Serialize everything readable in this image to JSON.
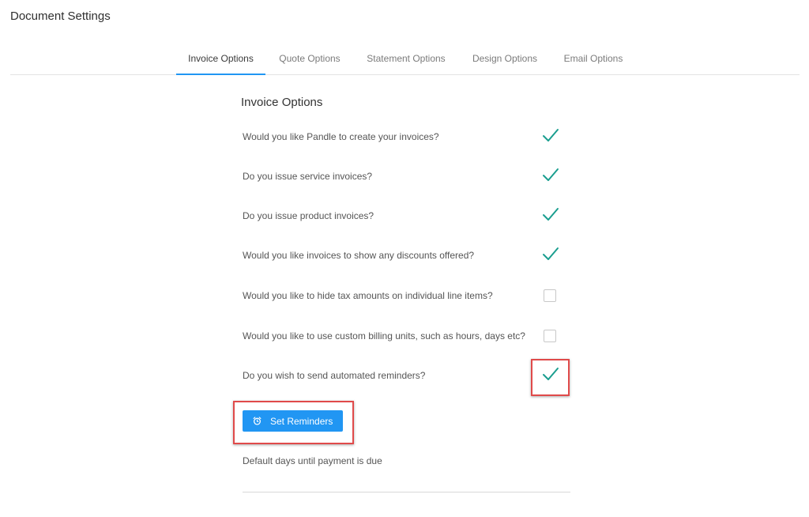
{
  "page": {
    "title": "Document Settings"
  },
  "tabs": [
    {
      "label": "Invoice Options",
      "active": true
    },
    {
      "label": "Quote Options",
      "active": false
    },
    {
      "label": "Statement Options",
      "active": false
    },
    {
      "label": "Design Options",
      "active": false
    },
    {
      "label": "Email Options",
      "active": false
    }
  ],
  "section": {
    "title": "Invoice Options"
  },
  "options": [
    {
      "label": "Would you like Pandle to create your invoices?",
      "checked": true
    },
    {
      "label": "Do you issue service invoices?",
      "checked": true
    },
    {
      "label": "Do you issue product invoices?",
      "checked": true
    },
    {
      "label": "Would you like invoices to show any discounts offered?",
      "checked": true
    },
    {
      "label": "Would you like to hide tax amounts on individual line items?",
      "checked": false
    },
    {
      "label": "Would you like to use custom billing units, such as hours, days etc?",
      "checked": false
    },
    {
      "label": "Do you wish to send automated reminders?",
      "checked": true
    }
  ],
  "reminders": {
    "button_label": "Set Reminders",
    "icon": "alarm-clock-icon"
  },
  "payment": {
    "default_days_label": "Default days until payment is due",
    "default_days_value": ""
  },
  "colors": {
    "accent": "#2196f3",
    "check": "#1a9e8f",
    "highlight": "#e04a4a"
  }
}
